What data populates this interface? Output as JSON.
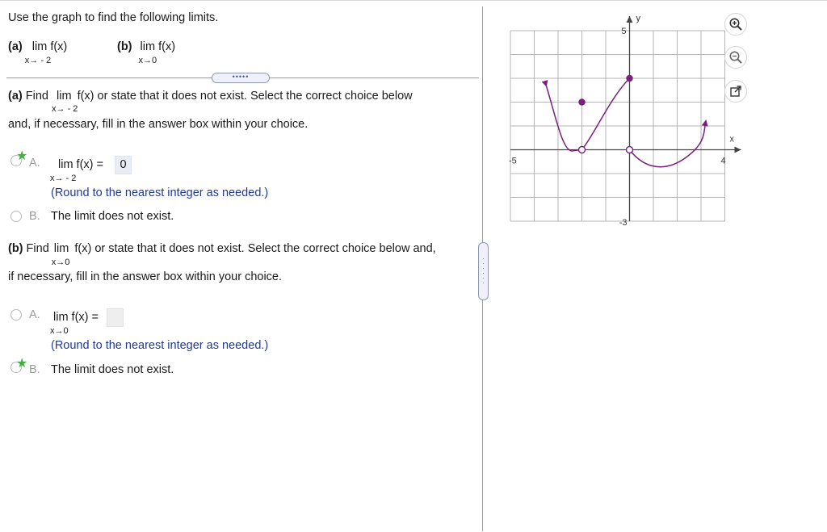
{
  "question": {
    "prompt": "Use the graph to find the following limits.",
    "part_a_label": "(a)",
    "part_a_lim": "lim  f(x)",
    "part_a_sub": "x→ - 2",
    "part_b_label": "(b)",
    "part_b_lim": "lim  f(x)",
    "part_b_sub": "x→0",
    "more_label": "•••••"
  },
  "part_a": {
    "label": "(a)",
    "find": "Find",
    "lim": "lim",
    "fx_text": "f(x) or state that it does not exist. Select the correct choice below",
    "sub": "x→ - 2",
    "line2": "and, if necessary, fill in the answer box within your choice.",
    "choice_a_letter": "A.",
    "choice_a_lim": "lim  f(x) =",
    "choice_a_sub": "x→ - 2",
    "choice_a_value": "0",
    "choice_a_hint": "(Round to the nearest integer as needed.)",
    "choice_b_letter": "B.",
    "choice_b_text": "The limit does not exist.",
    "correct": "A"
  },
  "part_b": {
    "label": "(b)",
    "find": "Find",
    "lim": "lim",
    "fx_text": "f(x) or state that it does not exist. Select the correct choice below and,",
    "sub": "x→0",
    "line2": "if necessary, fill in the answer box within your choice.",
    "choice_a_letter": "A.",
    "choice_a_lim": "lim  f(x) =",
    "choice_a_sub": "x→0",
    "choice_a_value": "",
    "choice_a_hint": "(Round to the nearest integer as needed.)",
    "choice_b_letter": "B.",
    "choice_b_text": "The limit does not exist.",
    "correct": "B"
  },
  "graph": {
    "y_label": "y",
    "x_label": "x",
    "y_top_tick": "5",
    "y_bottom_tick": "-3",
    "x_left_tick": "-5",
    "x_right_tick": "4",
    "curve_color": "#7b1f7e",
    "xlim": [
      -5,
      4
    ],
    "ylim": [
      -3,
      5
    ],
    "open_points": [
      [
        -2,
        0
      ],
      [
        0,
        0
      ]
    ],
    "closed_points": [
      [
        -2,
        2
      ],
      [
        0,
        3
      ]
    ]
  },
  "tools": {
    "zoom_in": "zoom-in-icon",
    "zoom_out": "zoom-out-icon",
    "popout": "popout-icon"
  },
  "colors": {
    "hint_blue": "#1f3a93",
    "star_green": "#3fb33a",
    "grid_gray": "#b5b5b5"
  }
}
